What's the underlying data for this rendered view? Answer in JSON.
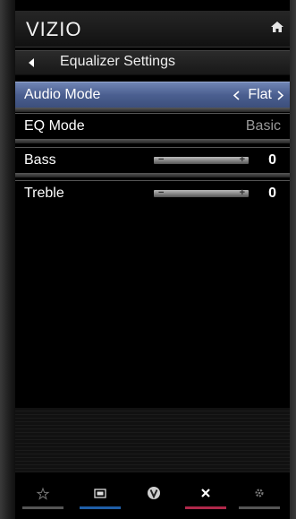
{
  "header": {
    "brand": "VIZIO",
    "home_icon": "home-icon"
  },
  "titlebar": {
    "title": "Equalizer Settings",
    "back_icon": "back-arrow-icon"
  },
  "menu": {
    "audio_mode": {
      "label": "Audio Mode",
      "value": "Flat"
    },
    "eq_mode": {
      "label": "EQ Mode",
      "value": "Basic"
    },
    "bass": {
      "label": "Bass",
      "value": "0",
      "minus": "−",
      "plus": "+",
      "level": 0.5
    },
    "treble": {
      "label": "Treble",
      "value": "0",
      "minus": "−",
      "plus": "+",
      "level": 0.5
    }
  },
  "footer": {
    "buttons": [
      {
        "name": "favorites",
        "icon": "star-icon",
        "color": "#555555"
      },
      {
        "name": "input",
        "icon": "input-icon",
        "color": "#1f5fa8"
      },
      {
        "name": "vizio",
        "icon": "vizio-v-icon",
        "color": "#777777"
      },
      {
        "name": "exit",
        "icon": "close-icon",
        "color": "#b0284a"
      },
      {
        "name": "settings",
        "icon": "gear-icon",
        "color": "#555555"
      }
    ]
  },
  "colors": {
    "selected_row": "#5a6e9e",
    "background": "#000000",
    "dim_text": "#9a9a9a"
  }
}
